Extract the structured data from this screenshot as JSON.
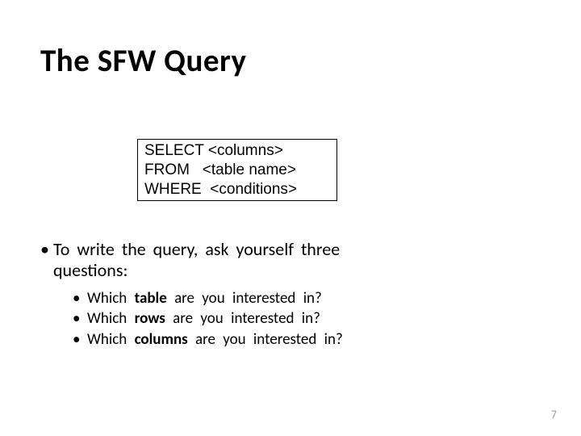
{
  "title": "The  SFW Query",
  "code": {
    "l1": "SELECT <columns>",
    "l2": "FROM   <table name>",
    "l3": "WHERE  <conditions>"
  },
  "bullet_main_part1": "To write the query, ask yourself three",
  "bullet_main_part2": "questions:",
  "sub": {
    "a_pre": "Which ",
    "a_bold": "table",
    "a_post": " are you interested in?",
    "b_pre": "Which ",
    "b_bold": "rows",
    "b_post": " are you interested in?",
    "c_pre": "Which ",
    "c_bold": "columns",
    "c_post": " are you interested in?"
  },
  "page_number": "7"
}
